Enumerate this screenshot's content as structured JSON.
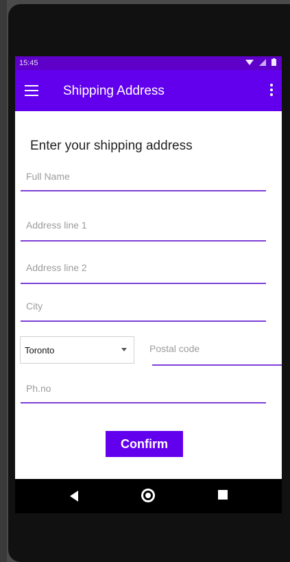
{
  "statusbar": {
    "time": "15:45",
    "icons": [
      "wifi-icon",
      "signal-icon",
      "battery-icon"
    ]
  },
  "appbar": {
    "title": "Shipping Address",
    "nav_icon": "menu-icon",
    "action_icon": "more-vert-icon"
  },
  "form": {
    "heading": "Enter your shipping address",
    "full_name": {
      "placeholder": "Full Name",
      "value": ""
    },
    "address1": {
      "placeholder": "Address line 1",
      "value": ""
    },
    "address2": {
      "placeholder": "Address line 2",
      "value": ""
    },
    "city": {
      "placeholder": "City",
      "value": ""
    },
    "province_select": {
      "selected": "Toronto"
    },
    "postal_code": {
      "placeholder": "Postal code",
      "value": ""
    },
    "phone": {
      "placeholder": "Ph.no",
      "value": ""
    },
    "confirm_label": "Confirm"
  },
  "navbar": {
    "icons": [
      "back-icon",
      "home-icon",
      "recents-icon"
    ]
  },
  "colors": {
    "primary": "#6200ee",
    "status": "#5e00c8",
    "underline": "#7d3fd6"
  }
}
